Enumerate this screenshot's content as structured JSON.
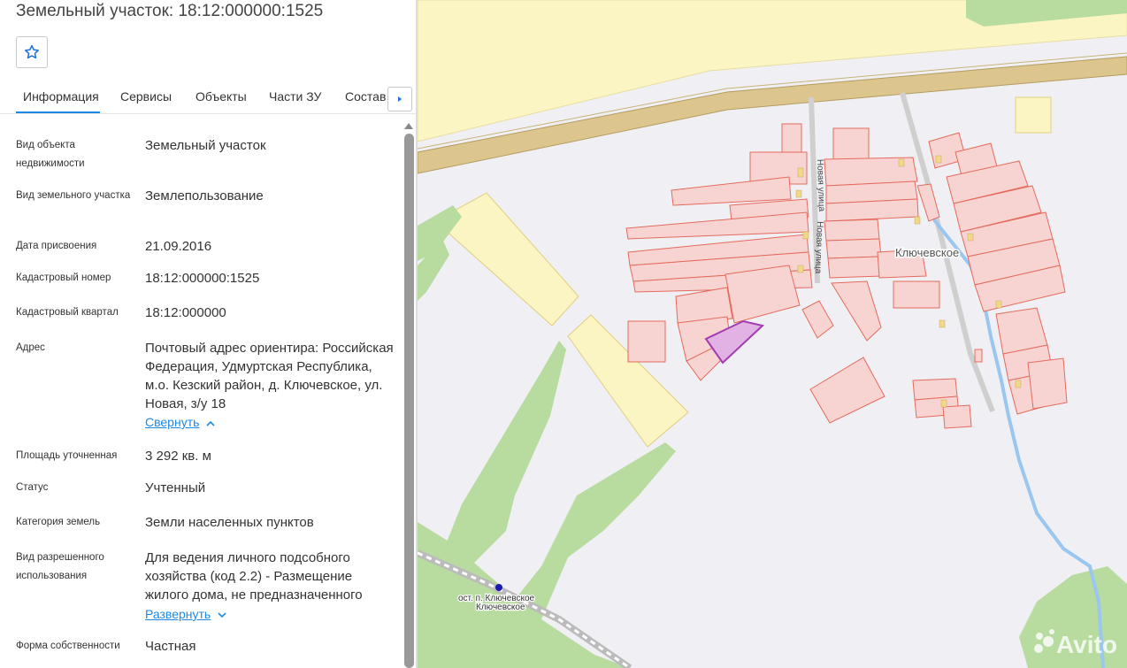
{
  "title": "Земельный участок: 18:12:000000:1525",
  "favorite_icon": "star-outline-icon",
  "tabs": [
    {
      "label": "Информация"
    },
    {
      "label": "Сервисы"
    },
    {
      "label": "Объекты"
    },
    {
      "label": "Части ЗУ"
    },
    {
      "label": "Состав"
    }
  ],
  "info": {
    "object_type_label": "Вид объекта недвижимости",
    "object_type_value": "Земельный участок",
    "land_type_label": "Вид земельного участка",
    "land_type_value": "Землепользование",
    "assign_date_label": "Дата присвоения",
    "assign_date_value": "21.09.2016",
    "cadastral_number_label": "Кадастровый номер",
    "cadastral_number_value": "18:12:000000:1525",
    "cadastral_quarter_label": "Кадастровый квартал",
    "cadastral_quarter_value": "18:12:000000",
    "address_label": "Адрес",
    "address_value": "Почтовый адрес ориентира: Российская Федерация, Удмуртская Республика, м.о. Кезский район, д. Ключевское, ул. Новая, з/у 18",
    "address_toggle": "Свернуть",
    "area_label": "Площадь уточненная",
    "area_value": "3 292 кв. м",
    "status_label": "Статус",
    "status_value": "Учтенный",
    "category_label": "Категория земель",
    "category_value": "Земли населенных пунктов",
    "permitted_use_label": "Вид разрешенного использования",
    "permitted_use_value": "Для ведения личного подсобного хозяйства (код 2.2) - Размещение жилого дома, не предназначенного",
    "permitted_use_toggle": "Развернуть",
    "ownership_label": "Форма собственности",
    "ownership_value": "Частная"
  },
  "map": {
    "village_label": "Ключевское",
    "street_label_1": "Новая улица",
    "street_label_2": "Новая улица",
    "stop_label_1": "ост. п. Ключевское",
    "stop_label_2": "Ключевское",
    "watermark": "Avito",
    "colors": {
      "forest": "#b8dba0",
      "farmland": "#fbf5c4",
      "parcel_fill": "#f7d4d2",
      "parcel_stroke": "#e46a5c",
      "selected_fill": "#e2b2e4",
      "selected_stroke": "#a23cb0",
      "river": "#9ac6f0",
      "road": "#d9c48a"
    }
  }
}
